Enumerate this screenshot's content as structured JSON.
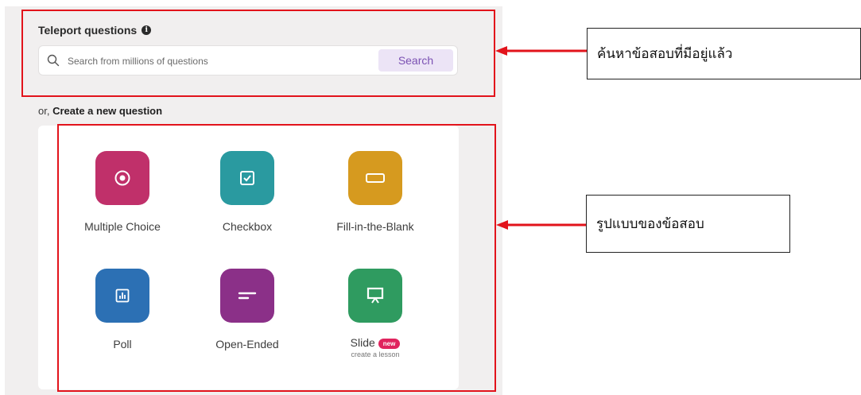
{
  "teleport": {
    "title": "Teleport questions",
    "search_placeholder": "Search from millions of questions",
    "search_button": "Search"
  },
  "create": {
    "prefix": "or, ",
    "label": "Create a new question"
  },
  "question_types": [
    {
      "label": "Multiple Choice",
      "color": "#c0306a",
      "icon": "radio-icon"
    },
    {
      "label": "Checkbox",
      "color": "#2a9aa0",
      "icon": "checkbox-icon"
    },
    {
      "label": "Fill-in-the-Blank",
      "color": "#d69a1f",
      "icon": "blank-icon"
    },
    {
      "label": "Poll",
      "color": "#2c70b4",
      "icon": "poll-icon"
    },
    {
      "label": "Open-Ended",
      "color": "#8b3088",
      "icon": "open-ended-icon"
    },
    {
      "label": "Slide",
      "color": "#2f9b60",
      "icon": "presentation-icon",
      "badge": "new",
      "sublabel": "create a lesson"
    }
  ],
  "annotations": {
    "search_callout": "ค้นหาข้อสอบที่มีอยู่แล้ว",
    "types_callout": "รูปแบบของข้อสอบ",
    "highlight_color": "#e2131b"
  }
}
